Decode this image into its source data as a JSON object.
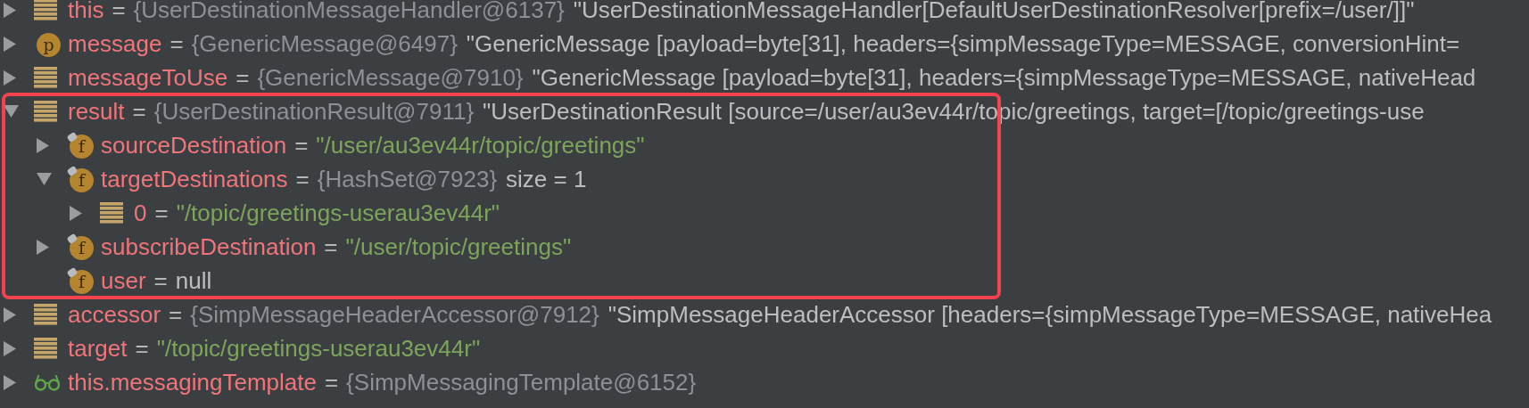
{
  "nodes": [
    {
      "kind": "variable",
      "name": "this",
      "equals": "=",
      "has_children": true,
      "expanded": false,
      "value": [
        {
          "kind": "ref",
          "text": "{UserDestinationMessageHandler@6137}"
        },
        {
          "kind": "text",
          "text": "\"UserDestinationMessageHandler[DefaultUserDestinationResolver[prefix=/user/]]\""
        }
      ]
    },
    {
      "kind": "parameter",
      "icon_letter": "p",
      "name": "message",
      "equals": "=",
      "has_children": true,
      "expanded": false,
      "value": [
        {
          "kind": "ref",
          "text": "{GenericMessage@6497}"
        },
        {
          "kind": "text",
          "text": "\"GenericMessage [payload=byte[31], headers={simpMessageType=MESSAGE, conversionHint="
        }
      ]
    },
    {
      "kind": "variable",
      "name": "messageToUse",
      "equals": "=",
      "has_children": true,
      "expanded": false,
      "value": [
        {
          "kind": "ref",
          "text": "{GenericMessage@7910}"
        },
        {
          "kind": "text",
          "text": "\"GenericMessage [payload=byte[31], headers={simpMessageType=MESSAGE, nativeHead"
        }
      ]
    },
    {
      "kind": "variable",
      "name": "result",
      "equals": "=",
      "has_children": true,
      "expanded": true,
      "highlighted": true,
      "value": [
        {
          "kind": "ref",
          "text": "{UserDestinationResult@7911}"
        },
        {
          "kind": "text",
          "text": "\"UserDestinationResult [source=/user/au3ev44r/topic/greetings, target=[/topic/greetings-use"
        }
      ],
      "children": [
        {
          "kind": "field",
          "icon_letter": "f",
          "name": "sourceDestination",
          "equals": "=",
          "has_children": true,
          "expanded": false,
          "value": [
            {
              "kind": "string",
              "text": "\"/user/au3ev44r/topic/greetings\""
            }
          ]
        },
        {
          "kind": "field",
          "icon_letter": "f",
          "name": "targetDestinations",
          "equals": "=",
          "has_children": true,
          "expanded": true,
          "value": [
            {
              "kind": "ref",
              "text": "{HashSet@7923}"
            },
            {
              "kind": "text",
              "text": "size = 1"
            }
          ],
          "children": [
            {
              "kind": "variable",
              "name": "0",
              "equals": "=",
              "has_children": true,
              "expanded": false,
              "value": [
                {
                  "kind": "string",
                  "text": "\"/topic/greetings-userau3ev44r\""
                }
              ]
            }
          ]
        },
        {
          "kind": "field",
          "icon_letter": "f",
          "name": "subscribeDestination",
          "equals": "=",
          "has_children": true,
          "expanded": false,
          "value": [
            {
              "kind": "string",
              "text": "\"/user/topic/greetings\""
            }
          ]
        },
        {
          "kind": "field",
          "icon_letter": "f",
          "name": "user",
          "equals": "=",
          "has_children": false,
          "expanded": false,
          "value": [
            {
              "kind": "text",
              "text": "null"
            }
          ]
        }
      ]
    },
    {
      "kind": "variable",
      "name": "accessor",
      "equals": "=",
      "has_children": true,
      "expanded": false,
      "value": [
        {
          "kind": "ref",
          "text": "{SimpMessageHeaderAccessor@7912}"
        },
        {
          "kind": "text",
          "text": "\"SimpMessageHeaderAccessor [headers={simpMessageType=MESSAGE, nativeHea"
        }
      ]
    },
    {
      "kind": "variable",
      "name": "target",
      "equals": "=",
      "has_children": true,
      "expanded": false,
      "value": [
        {
          "kind": "string",
          "text": "\"/topic/greetings-userau3ev44r\""
        }
      ]
    },
    {
      "kind": "watch",
      "name": "this.messagingTemplate",
      "equals": "=",
      "has_children": true,
      "expanded": false,
      "value": [
        {
          "kind": "ref",
          "text": "{SimpMessagingTemplate@6152}"
        }
      ]
    }
  ]
}
